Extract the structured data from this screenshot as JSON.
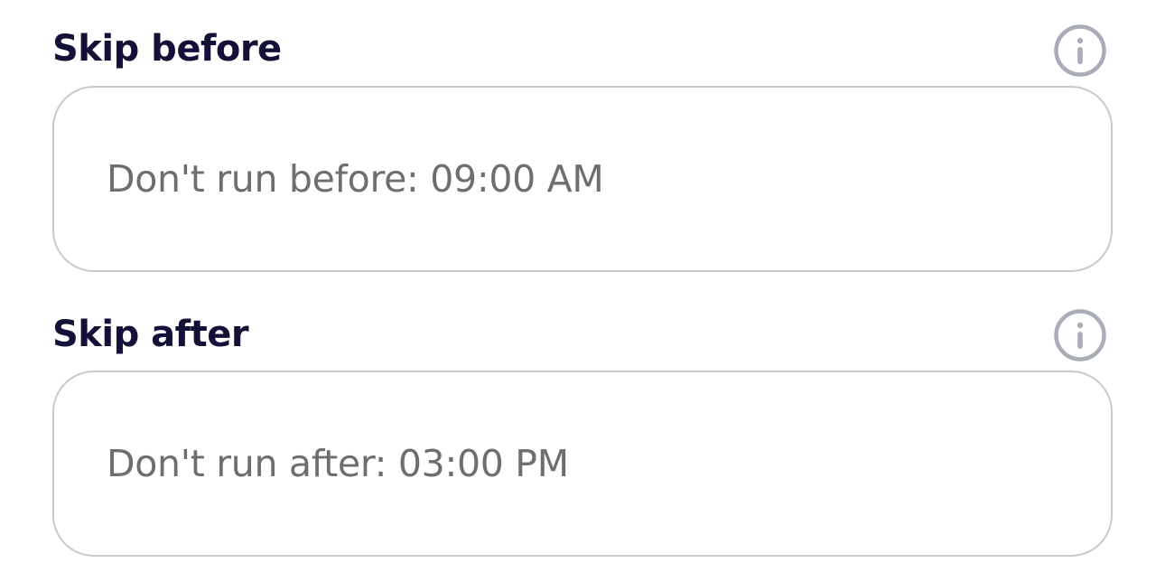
{
  "skip_before": {
    "label": "Skip before",
    "field_text": "Don't run before: 09:00 AM",
    "info_icon": "info-circle-icon"
  },
  "skip_after": {
    "label": "Skip after",
    "field_text": "Don't run after: 03:00 PM",
    "info_icon": "info-circle-icon"
  },
  "colors": {
    "label": "#141138",
    "field_text": "#6e6e70",
    "field_border": "#c9c9cb",
    "icon": "#a9adb7"
  }
}
